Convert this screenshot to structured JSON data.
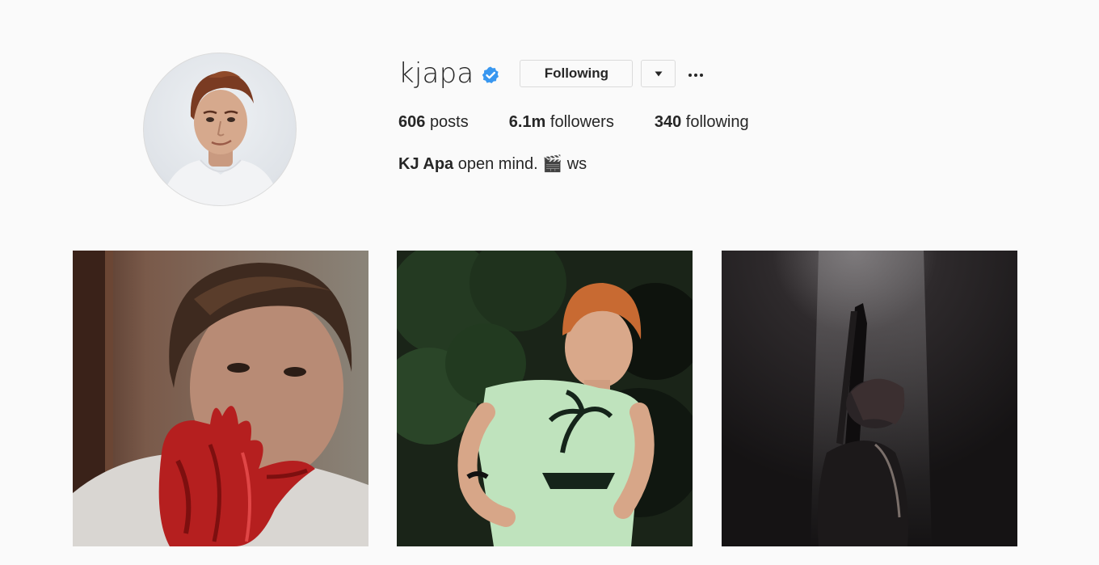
{
  "profile": {
    "username": "kjapa",
    "verified": true,
    "following_label": "Following",
    "dropdown_icon": "caret-down-icon",
    "more_icon": "ellipsis-icon"
  },
  "stats": {
    "posts_count": "606",
    "posts_label": "posts",
    "followers_count": "6.1m",
    "followers_label": "followers",
    "following_count": "340",
    "following_label": "following"
  },
  "bio": {
    "full_name": "KJ Apa",
    "text_before": "open mind.",
    "emoji": "🎬",
    "text_after": "ws"
  },
  "colors": {
    "background": "#fafafa",
    "text": "#262626",
    "border": "#dbdbdb",
    "verified_blue": "#3897f0"
  },
  "posts": [
    {
      "thumbnail": "photo-bloody-hand"
    },
    {
      "thumbnail": "photo-green-shirt-night"
    },
    {
      "thumbnail": "photo-dark-silhouette"
    }
  ]
}
